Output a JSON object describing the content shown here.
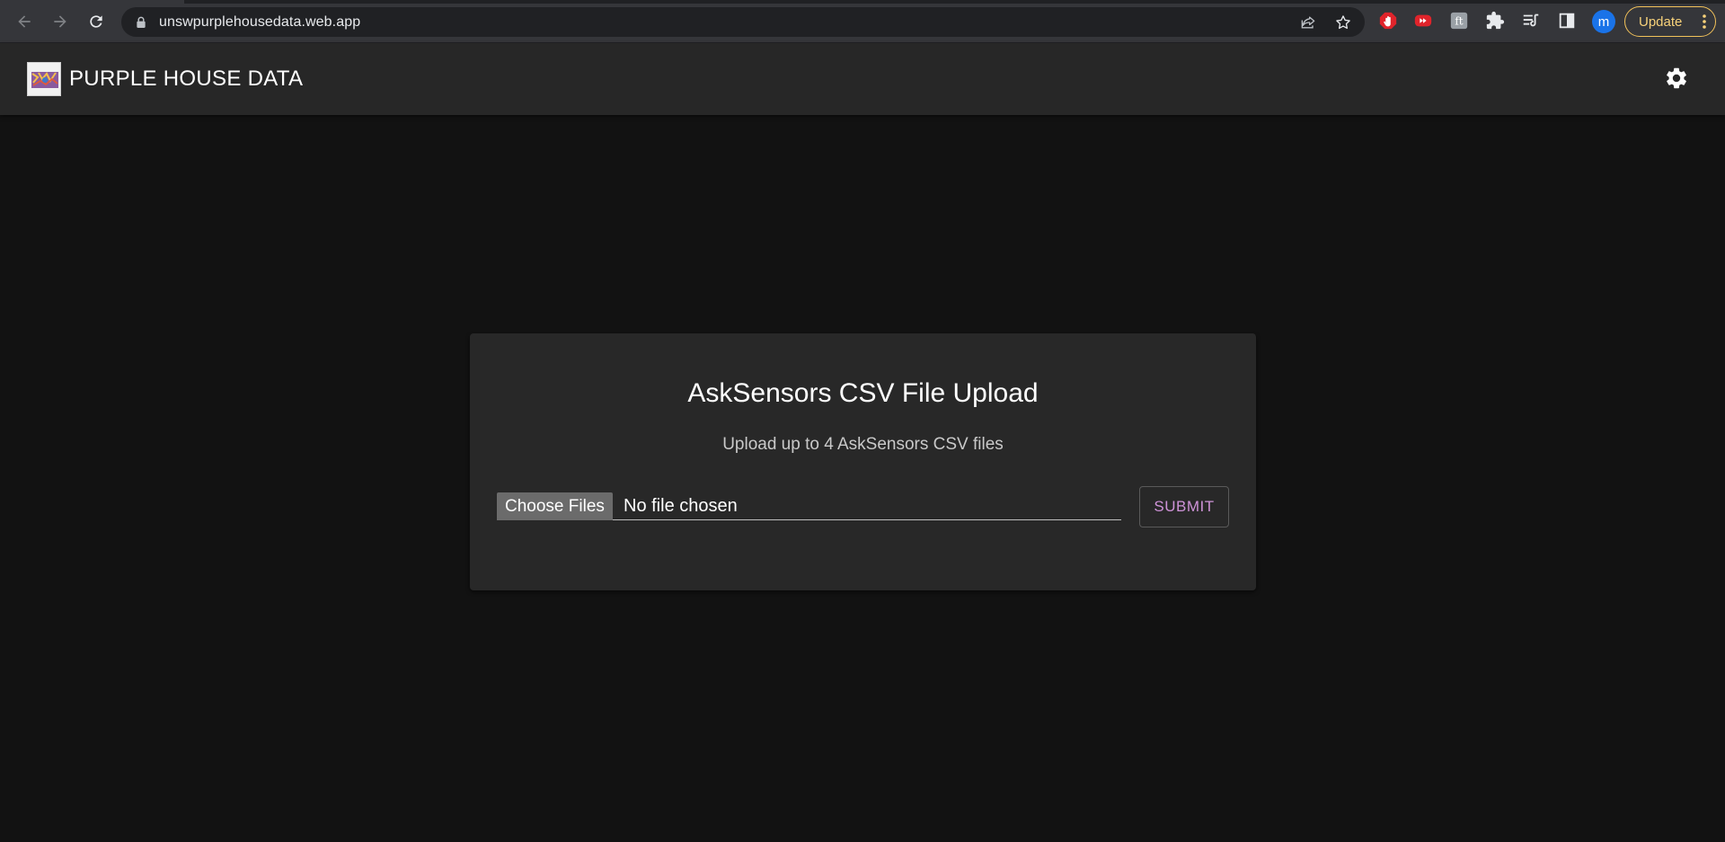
{
  "browser": {
    "url": "unswpurplehousedata.web.app",
    "profile_initial": "m",
    "update_label": "Update"
  },
  "app": {
    "title": "PURPLE HOUSE DATA"
  },
  "upload_card": {
    "title": "AskSensors CSV File Upload",
    "subtitle": "Upload up to 4 AskSensors CSV files",
    "choose_files_label": "Choose Files",
    "file_status": "No file chosen",
    "submit_label": "SUBMIT"
  },
  "colors": {
    "accent": "#ce93d8",
    "background": "#121212",
    "card": "#282828",
    "appbar": "#272727"
  }
}
